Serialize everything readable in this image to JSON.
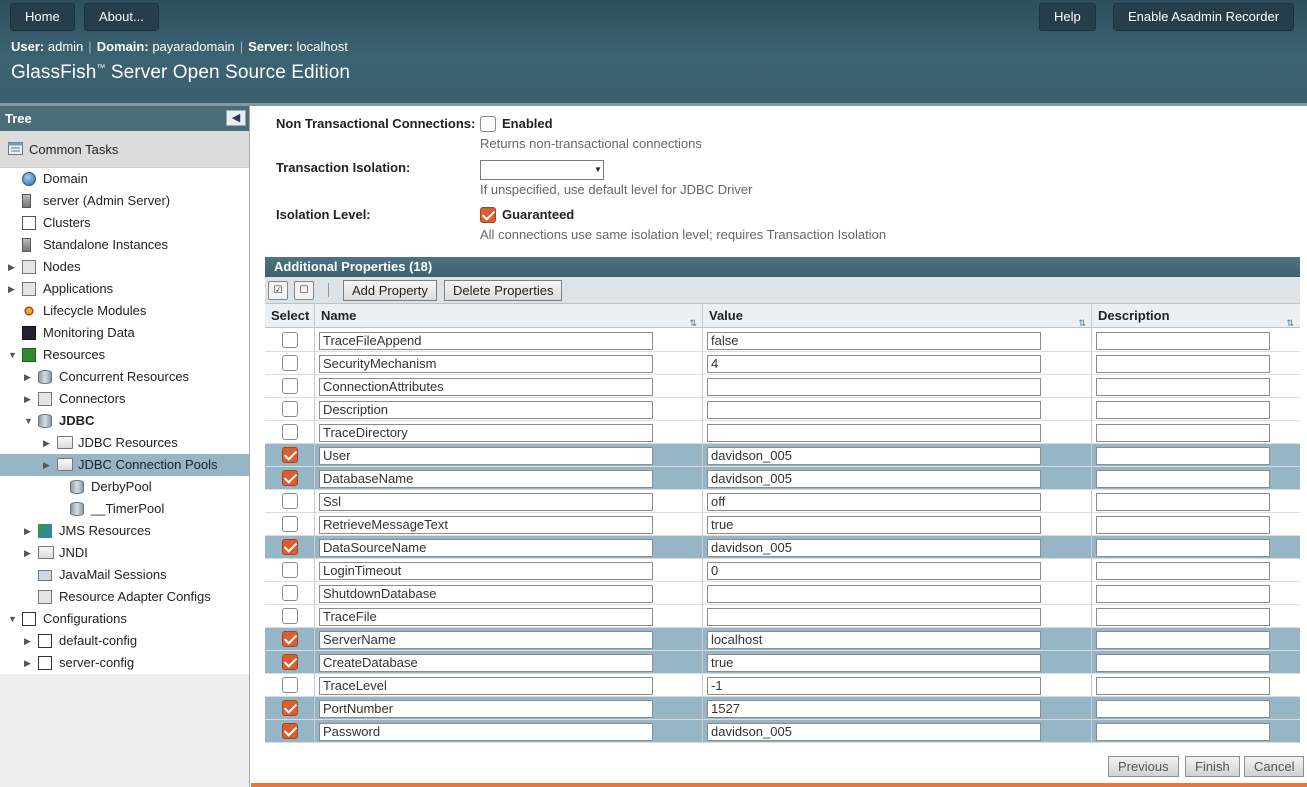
{
  "masthead": {
    "home_label": "Home",
    "about_label": "About...",
    "help_label": "Help",
    "recorder_label": "Enable Asadmin Recorder",
    "user_label": "User:",
    "user_value": "admin",
    "domain_label": "Domain:",
    "domain_value": "payaradomain",
    "server_label": "Server:",
    "server_value": "localhost",
    "product_name": "GlassFish",
    "product_tm": "™",
    "product_rest": " Server Open Source Edition"
  },
  "tree": {
    "title": "Tree",
    "collapse_icon": "chevron-left-icon",
    "common_tasks": "Common Tasks",
    "nodes": [
      {
        "label": "Domain",
        "icon": "globe-icon",
        "level": 0,
        "toggle": ""
      },
      {
        "label": "server (Admin Server)",
        "icon": "server-icon",
        "level": 0,
        "toggle": ""
      },
      {
        "label": "Clusters",
        "icon": "cluster-icon",
        "level": 0,
        "toggle": ""
      },
      {
        "label": "Standalone Instances",
        "icon": "server-icon",
        "level": 0,
        "toggle": ""
      },
      {
        "label": "Nodes",
        "icon": "nodes-icon",
        "level": 0,
        "toggle": "▶"
      },
      {
        "label": "Applications",
        "icon": "applications-icon",
        "level": 0,
        "toggle": "▶"
      },
      {
        "label": "Lifecycle Modules",
        "icon": "lifecycle-icon",
        "level": 0,
        "toggle": ""
      },
      {
        "label": "Monitoring Data",
        "icon": "monitor-icon",
        "level": 0,
        "toggle": ""
      },
      {
        "label": "Resources",
        "icon": "resources-icon",
        "level": 0,
        "toggle": "▼"
      },
      {
        "label": "Concurrent Resources",
        "icon": "database-icon",
        "level": 1,
        "toggle": "▶"
      },
      {
        "label": "Connectors",
        "icon": "connector-icon",
        "level": 1,
        "toggle": "▶"
      },
      {
        "label": "JDBC",
        "icon": "database-icon",
        "level": 1,
        "toggle": "▼",
        "bold": true
      },
      {
        "label": "JDBC Resources",
        "icon": "folder-icon",
        "level": 2,
        "toggle": "▶"
      },
      {
        "label": "JDBC Connection Pools",
        "icon": "folder-icon",
        "level": 2,
        "toggle": "▶",
        "selected": true
      },
      {
        "label": "DerbyPool",
        "icon": "database-icon",
        "level": 3,
        "toggle": ""
      },
      {
        "label": "__TimerPool",
        "icon": "database-icon",
        "level": 3,
        "toggle": ""
      },
      {
        "label": "JMS Resources",
        "icon": "jms-icon",
        "level": 1,
        "toggle": "▶"
      },
      {
        "label": "JNDI",
        "icon": "folder-icon",
        "level": 1,
        "toggle": "▶"
      },
      {
        "label": "JavaMail Sessions",
        "icon": "mail-icon",
        "level": 1,
        "toggle": ""
      },
      {
        "label": "Resource Adapter Configs",
        "icon": "connector-icon",
        "level": 1,
        "toggle": ""
      },
      {
        "label": "Configurations",
        "icon": "config-icon",
        "level": 0,
        "toggle": "▼"
      },
      {
        "label": "default-config",
        "icon": "config-icon",
        "level": 1,
        "toggle": "▶"
      },
      {
        "label": "server-config",
        "icon": "config-icon",
        "level": 1,
        "toggle": "▶"
      }
    ]
  },
  "form": {
    "non_tx_label": "Non Transactional Connections:",
    "non_tx_checkbox_label": "Enabled",
    "non_tx_checked": false,
    "non_tx_help": "Returns non-transactional connections",
    "tx_isolation_label": "Transaction Isolation:",
    "tx_isolation_value": "",
    "tx_isolation_help": "If unspecified, use default level for JDBC Driver",
    "isolation_level_label": "Isolation Level:",
    "isolation_checkbox_label": "Guaranteed",
    "isolation_checked": true,
    "isolation_help": "All connections use same isolation level; requires Transaction Isolation"
  },
  "properties": {
    "title": "Additional Properties (18)",
    "add_label": "Add Property",
    "delete_label": "Delete Properties",
    "select_all_icon": "select-all-icon",
    "deselect_all_icon": "deselect-all-icon",
    "columns": {
      "select": "Select",
      "name": "Name",
      "value": "Value",
      "description": "Description"
    },
    "sort_icon": "sort-icon",
    "rows": [
      {
        "name": "TraceFileAppend",
        "value": "false",
        "description": "",
        "selected": false
      },
      {
        "name": "SecurityMechanism",
        "value": "4",
        "description": "",
        "selected": false
      },
      {
        "name": "ConnectionAttributes",
        "value": "",
        "description": "",
        "selected": false
      },
      {
        "name": "Description",
        "value": "",
        "description": "",
        "selected": false
      },
      {
        "name": "TraceDirectory",
        "value": "",
        "description": "",
        "selected": false
      },
      {
        "name": "User",
        "value": "davidson_005",
        "description": "",
        "selected": true
      },
      {
        "name": "DatabaseName",
        "value": "davidson_005",
        "description": "",
        "selected": true
      },
      {
        "name": "Ssl",
        "value": "off",
        "description": "",
        "selected": false
      },
      {
        "name": "RetrieveMessageText",
        "value": "true",
        "description": "",
        "selected": false
      },
      {
        "name": "DataSourceName",
        "value": "davidson_005",
        "description": "",
        "selected": true
      },
      {
        "name": "LoginTimeout",
        "value": "0",
        "description": "",
        "selected": false
      },
      {
        "name": "ShutdownDatabase",
        "value": "",
        "description": "",
        "selected": false
      },
      {
        "name": "TraceFile",
        "value": "",
        "description": "",
        "selected": false
      },
      {
        "name": "ServerName",
        "value": "localhost",
        "description": "",
        "selected": true
      },
      {
        "name": "CreateDatabase",
        "value": "true",
        "description": "",
        "selected": true
      },
      {
        "name": "TraceLevel",
        "value": "-1",
        "description": "",
        "selected": false
      },
      {
        "name": "PortNumber",
        "value": "1527",
        "description": "",
        "selected": true
      },
      {
        "name": "Password",
        "value": "davidson_005",
        "description": "",
        "selected": true
      }
    ]
  },
  "footer": {
    "previous_label": "Previous",
    "finish_label": "Finish",
    "cancel_label": "Cancel"
  },
  "colors": {
    "masthead": "#3c6373",
    "selected_row": "#96b6c8",
    "checkbox_checked": "#d95f31",
    "accent_strip": "#e8753c"
  }
}
